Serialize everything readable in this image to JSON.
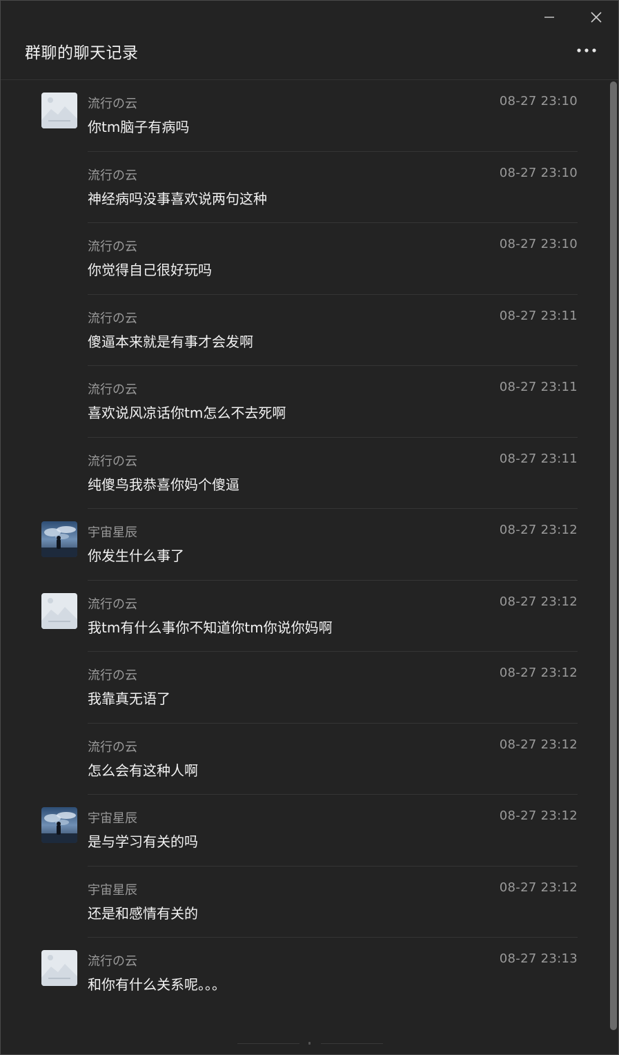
{
  "window": {
    "title": "群聊的聊天记录"
  },
  "icons": {
    "minimize": "minimize-icon",
    "close": "close-icon",
    "more": "more-dots-icon"
  },
  "messages": [
    {
      "sender": "流行の云",
      "time": "08-27 23:10",
      "text": "你tm脑子有病吗",
      "avatar": "placeholder"
    },
    {
      "sender": "流行の云",
      "time": "08-27 23:10",
      "text": "神经病吗没事喜欢说两句这种",
      "avatar": ""
    },
    {
      "sender": "流行の云",
      "time": "08-27 23:10",
      "text": "你觉得自己很好玩吗",
      "avatar": ""
    },
    {
      "sender": "流行の云",
      "time": "08-27 23:11",
      "text": "傻逼本来就是有事才会发啊",
      "avatar": ""
    },
    {
      "sender": "流行の云",
      "time": "08-27 23:11",
      "text": "喜欢说风凉话你tm怎么不去死啊",
      "avatar": ""
    },
    {
      "sender": "流行の云",
      "time": "08-27 23:11",
      "text": "纯傻鸟我恭喜你妈个傻逼",
      "avatar": ""
    },
    {
      "sender": "宇宙星辰",
      "time": "08-27 23:12",
      "text": "你发生什么事了",
      "avatar": "scenic"
    },
    {
      "sender": "流行の云",
      "time": "08-27 23:12",
      "text": "我tm有什么事你不知道你tm你说你妈啊",
      "avatar": "placeholder"
    },
    {
      "sender": "流行の云",
      "time": "08-27 23:12",
      "text": "我靠真无语了",
      "avatar": ""
    },
    {
      "sender": "流行の云",
      "time": "08-27 23:12",
      "text": "怎么会有这种人啊",
      "avatar": ""
    },
    {
      "sender": "宇宙星辰",
      "time": "08-27 23:12",
      "text": "是与学习有关的吗",
      "avatar": "scenic"
    },
    {
      "sender": "宇宙星辰",
      "time": "08-27 23:12",
      "text": "还是和感情有关的",
      "avatar": ""
    },
    {
      "sender": "流行の云",
      "time": "08-27 23:13",
      "text": "和你有什么关系呢。。。",
      "avatar": "placeholder"
    }
  ]
}
